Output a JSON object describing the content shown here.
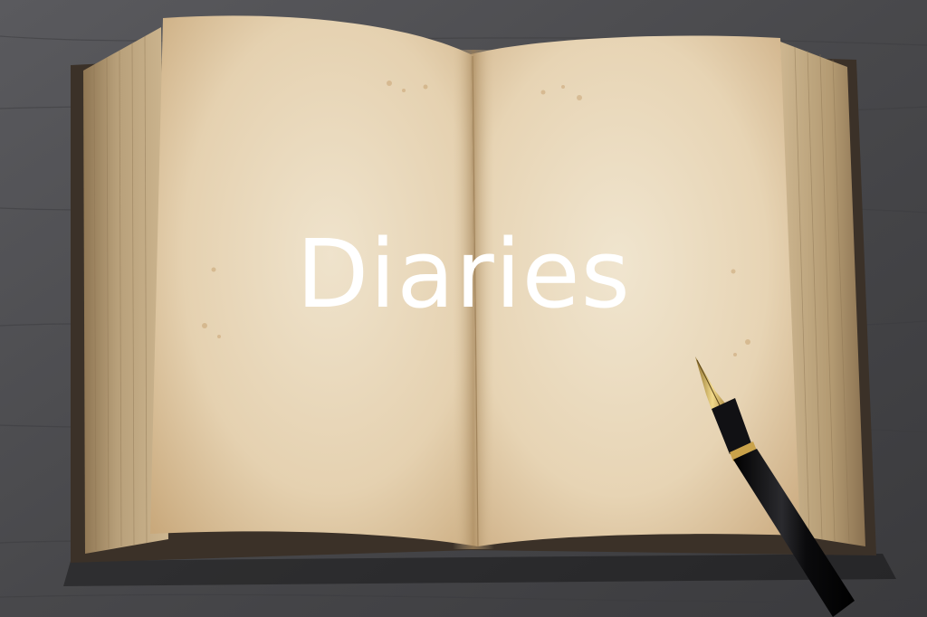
{
  "banner": {
    "title": "Diaries"
  },
  "scene": {
    "subject": "open-book",
    "accessory": "fountain-pen-icon",
    "colors": {
      "desk": "#4a4a4d",
      "page": "#e6d3b3",
      "page_edge": "#b8976b",
      "cover": "#3b3128",
      "pen_body": "#0d0d0f",
      "pen_trim": "#c9a24a",
      "title_text": "#ffffff"
    }
  }
}
